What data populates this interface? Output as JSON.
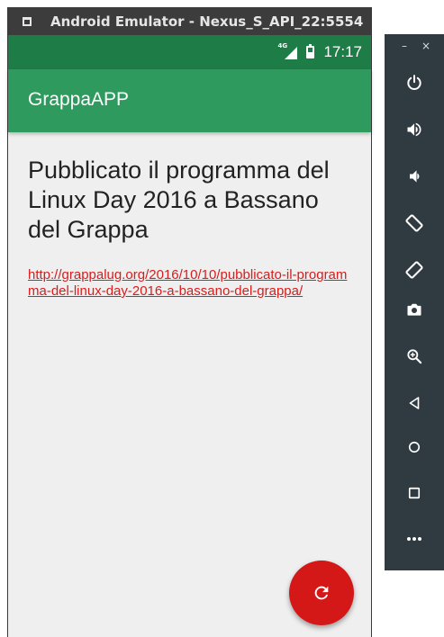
{
  "window": {
    "title": "Android Emulator - Nexus_S_API_22:5554"
  },
  "status_bar": {
    "network_label": "4G",
    "time": "17:17"
  },
  "app_bar": {
    "title": "GrappaAPP"
  },
  "post": {
    "title": "Pubblicato il programma del Linux Day 2016 a Bassano del Grappa",
    "link": "http://grappalug.org/2016/10/10/pubblicato-il-programma-del-linux-day-2016-a-bassano-del-grappa/"
  },
  "fab": {
    "icon": "refresh-icon"
  },
  "toolbar": {
    "minimize_glyph": "–",
    "close_glyph": "×",
    "buttons": [
      {
        "icon": "power-icon"
      },
      {
        "icon": "volume-up-icon"
      },
      {
        "icon": "volume-down-icon"
      },
      {
        "icon": "rotate-left-icon"
      },
      {
        "icon": "rotate-right-icon"
      },
      {
        "icon": "camera-icon"
      },
      {
        "icon": "zoom-icon"
      },
      {
        "icon": "back-icon"
      },
      {
        "icon": "home-icon"
      },
      {
        "icon": "overview-icon"
      },
      {
        "icon": "more-icon"
      }
    ]
  },
  "colors": {
    "status_bar": "#1e7d46",
    "app_bar": "#2e9a5e",
    "accent": "#d41717",
    "link": "#d91c1c",
    "toolbar": "#2f3b40"
  }
}
